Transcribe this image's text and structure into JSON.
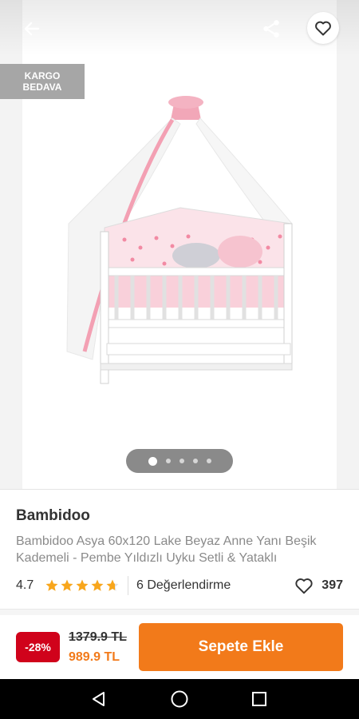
{
  "header": {
    "back_icon": "arrow-left-icon",
    "share_icon": "share-icon",
    "favorite_icon": "heart-outline-icon"
  },
  "gallery": {
    "badge_line1": "KARGO",
    "badge_line2": "BEDAVA",
    "image_count": 5,
    "active_image": 1
  },
  "product": {
    "brand": "Bambidoo",
    "title": "Bambidoo Asya 60x120 Lake Beyaz Anne Yanı Beşik Kademeli - Pembe Yıldızlı Uyku Setli & Yataklı",
    "rating": "4.7",
    "rating_stars": 4.7,
    "review_count": "6 Değerlendirme",
    "like_count": "397"
  },
  "purchase": {
    "discount": "-28%",
    "old_price": "1379.9 TL",
    "new_price": "989.9 TL",
    "add_to_cart": "Sepete Ekle"
  },
  "colors": {
    "accent": "#f27a1a",
    "discount": "#d0021b",
    "star": "#f8a61c"
  },
  "system_nav": {
    "back": "triangle-back-icon",
    "home": "circle-home-icon",
    "recents": "square-recents-icon"
  }
}
